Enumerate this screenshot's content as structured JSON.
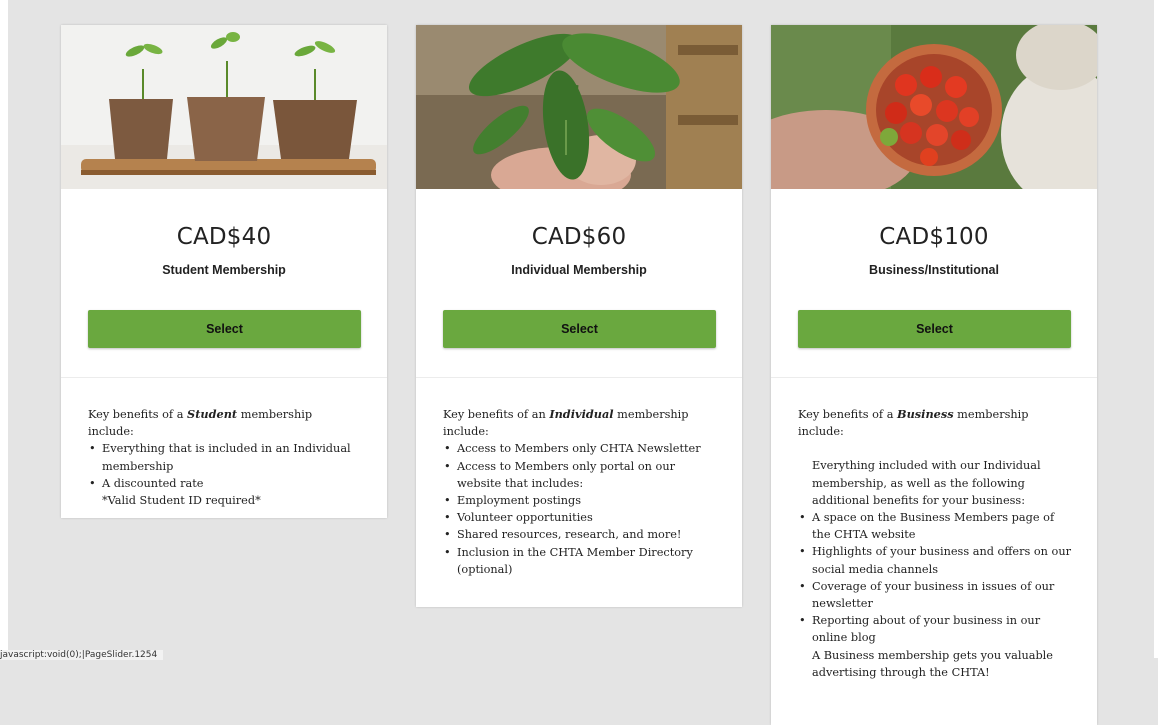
{
  "cards": [
    {
      "price": "CAD$40",
      "name": "Student Membership",
      "button": "Select",
      "intro_pre": "Key benefits of a ",
      "intro_em": "Student",
      "intro_post": " membership include:",
      "items": [
        "Everything that is included in an Individual membership",
        "A discounted rate"
      ],
      "note": "*Valid Student ID required*"
    },
    {
      "price": "CAD$60",
      "name": "Individual Membership",
      "button": "Select",
      "intro_pre": "Key benefits of an ",
      "intro_em": "Individual",
      "intro_post": " membership include:",
      "items": [
        "Access to Members only CHTA Newsletter",
        "Access to Members only portal on our website that includes:",
        "Employment postings",
        "Volunteer opportunities",
        "Shared resources, research, and more!",
        "Inclusion in the CHTA Member Directory (optional)"
      ]
    },
    {
      "price": "CAD$100",
      "name": "Business/Institutional",
      "button": "Select",
      "intro_pre": "Key benefits of a ",
      "intro_em": "Business",
      "intro_post": " membership include:",
      "paragraph": "Everything included with our Individual membership, as well as the following additional benefits for your business:",
      "items": [
        "A space on the Business Members page of the CHTA website",
        "Highlights of your business and offers on our social media channels",
        "Coverage of your business in issues of our newsletter",
        "Reporting about of your business in our online blog"
      ],
      "closing": "A Business membership gets you valuable advertising through the CHTA!"
    }
  ],
  "status_url": "javascript:void(0);|PageSlider.1254"
}
